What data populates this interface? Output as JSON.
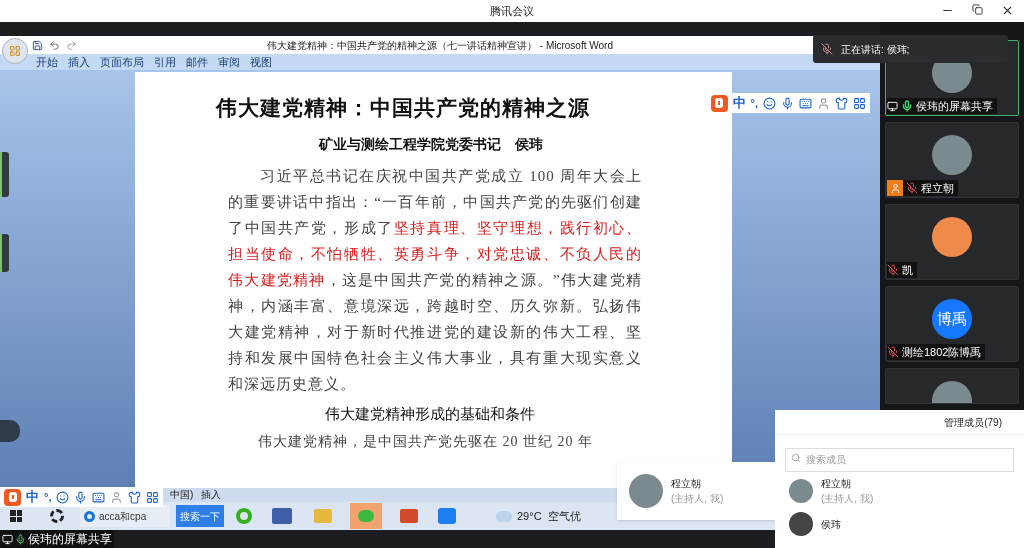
{
  "app_title": "腾讯会议",
  "word": {
    "title": "伟大建党精神：中国共产党的精神之源（七一讲话精神宣讲） - Microsoft Word",
    "tabs": [
      {
        "label": "开始"
      },
      {
        "label": "插入"
      },
      {
        "label": "页面布局"
      },
      {
        "label": "引用"
      },
      {
        "label": "邮件"
      },
      {
        "label": "审阅"
      },
      {
        "label": "视图"
      }
    ],
    "doc_title": "伟大建党精神：中国共产党的精神之源",
    "byline": "矿业与测绘工程学院党委书记　侯玮",
    "paragraph": [
      {
        "text": "习近平总书记在庆祝中国共产党成立 100 周年大会上的重要讲话中指出：“一百年前，中国共产党的先驱们创建了中国共产党，形成了",
        "emphasis": false
      },
      {
        "text": "坚持真理、坚守理想，践行初心、担当使命，不怕牺牲、英勇斗争，对党忠诚、不负人民的伟大建党精神",
        "emphasis": true
      },
      {
        "text": "，这是中国共产党的精神之源。”伟大建党精神，内涵丰富、意境深远，跨越时空、历久弥新。弘扬伟大建党精神，对于新时代推进党的建设新的伟大工程、坚持和发展中国特色社会主义伟大事业，具有重大现实意义和深远历史意义。",
        "emphasis": false
      }
    ],
    "heading": "伟大建党精神形成的基础和条件",
    "next_line": "伟大建党精神，是中国共产党先驱在 20 世纪 20 年",
    "status": [
      "中国)",
      "插入"
    ]
  },
  "ime_bars": [
    {
      "mode": "中",
      "punct": "°,"
    },
    {
      "mode": "中",
      "punct": "°,"
    }
  ],
  "taskbar": {
    "browser_tab": "acca和cpa",
    "search_button": "搜索一下",
    "weather": "29°C",
    "air": "空气优"
  },
  "share_label": "侯玮的屏幕共享",
  "speaking": "正在讲话: 侯玮;",
  "tiles": [
    {
      "label": "侯玮的屏幕共享",
      "avatar": {
        "kind": "photo"
      },
      "active": true,
      "mic_on": true,
      "sharing": true,
      "host": false
    },
    {
      "label": "程立朝",
      "avatar": {
        "kind": "photo"
      },
      "active": false,
      "mic_on": false,
      "sharing": false,
      "host": true
    },
    {
      "label": "凯",
      "avatar": {
        "kind": "cartoon"
      },
      "active": false,
      "mic_on": false,
      "sharing": false,
      "host": false
    },
    {
      "label": "测绘1802陈博禹",
      "avatar": {
        "kind": "text",
        "text": "博禹"
      },
      "active": false,
      "mic_on": false,
      "sharing": false,
      "host": false
    },
    {
      "avatar": {
        "kind": "photo"
      },
      "active": false
    }
  ],
  "hover_card": {
    "name": "程立朝",
    "role": "(主持人, 我)"
  },
  "members": {
    "title": "管理成员(79)",
    "search": {
      "placeholder": "搜索成员"
    },
    "items": [
      {
        "name": "程立朝",
        "role": "(主持人, 我)"
      },
      {
        "name": "侯玮"
      }
    ]
  }
}
